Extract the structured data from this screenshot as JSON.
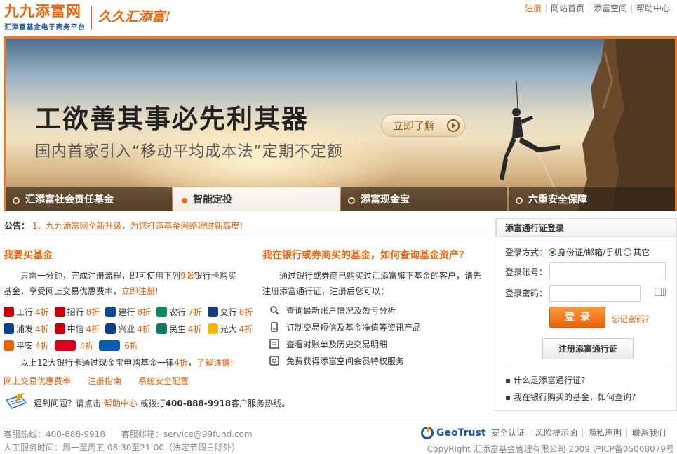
{
  "header": {
    "logo_text": "九九添富网",
    "logo_subtitle": "汇添富基金电子商务平台",
    "slogan": "久久汇添富!",
    "nav": [
      "注册",
      "网站首页",
      "添富空间",
      "帮助中心"
    ]
  },
  "banner": {
    "headline": "工欲善其事必先利其器",
    "subline": "国内首家引入“移动平均成本法”定期不定额",
    "cta_label": "立即了解",
    "tabs": [
      {
        "label": "汇添富社会责任基金",
        "active": false
      },
      {
        "label": "智能定投",
        "active": true
      },
      {
        "label": "添富现金宝",
        "active": false
      },
      {
        "label": "六重安全保障",
        "active": false
      }
    ]
  },
  "notice": {
    "label": "公告：",
    "text": "1、九九添富网全新升级，为您打造基金网络理财新高度!"
  },
  "buy": {
    "title": "我要买基金",
    "intro_before": "只需一分钟，完成注册流程，即可使用下列",
    "intro_count": "9张",
    "intro_after": "银行卡购买基金，享受网上交易优惠费率，",
    "register_link": "立即注册!",
    "banks": [
      [
        {
          "name": "工行",
          "discount": "4折",
          "color": "#c7000b"
        },
        {
          "name": "招行",
          "discount": "8折",
          "color": "#c7000b"
        },
        {
          "name": "建行",
          "discount": "8折",
          "color": "#0b4a9a"
        },
        {
          "name": "农行",
          "discount": "7折",
          "color": "#0a8a5d"
        },
        {
          "name": "交行",
          "discount": "8折",
          "color": "#173b7a"
        }
      ],
      [
        {
          "name": "浦发",
          "discount": "4折",
          "color": "#0a3e8f"
        },
        {
          "name": "中信",
          "discount": "4折",
          "color": "#c7000b"
        },
        {
          "name": "兴业",
          "discount": "4折",
          "color": "#0a3e8f"
        },
        {
          "name": "民生",
          "discount": "4折",
          "color": "#0a7a66"
        },
        {
          "name": "光大",
          "discount": "4折",
          "color": "#f2b705"
        }
      ],
      [
        {
          "name": "平安",
          "discount": "4折",
          "color": "#e8630a"
        },
        {
          "name": "",
          "discount": "4折",
          "color": "#d9001b"
        },
        {
          "name": "",
          "discount": "6折",
          "color": "#0a5bb5"
        }
      ]
    ],
    "note_before": "以上12大银行卡通过现金宝申购基金一律",
    "note_discount": "4折",
    "note_after": "，",
    "note_link": "了解详情!",
    "links": [
      "网上交易优惠费率",
      "注册指南",
      "系统安全配置"
    ]
  },
  "query": {
    "title": "我在银行或券商买的基金，如何查询基金资产？",
    "intro": "通过银行或券商已购买过汇添富旗下基金的客户，请先注册添富通行证，注册后您可以：",
    "features": [
      {
        "icon": "search-icon",
        "text": "查询最新账户情况及盈亏分析"
      },
      {
        "icon": "phone-icon",
        "text": "订制交易短信及基金净值等资讯产品"
      },
      {
        "icon": "statement-icon",
        "text": "查看对账单及历史交易明细"
      },
      {
        "icon": "smile-icon",
        "text": "免费获得添富空间会员特权服务"
      }
    ]
  },
  "help": {
    "before": "遇到问题？请点击",
    "link": "帮助中心",
    "middle": "或拨打",
    "phone": "400-888-9918",
    "after": "客户服务热线。"
  },
  "login": {
    "title": "添富通行证登录",
    "method_label": "登录方式：",
    "method_options": [
      "身份证/邮箱/手机",
      "其它"
    ],
    "account_label": "登录账号：",
    "account_value": "",
    "password_label": "登录密码：",
    "password_value": "",
    "login_button": "登录",
    "forgot_link": "忘记密码?",
    "register_button": "注册添富通行证",
    "questions": [
      "什么是添富通行证?",
      "我在银行购买的基金，如何查询?"
    ]
  },
  "footer": {
    "hotline": "客服热线：400-888-9918",
    "email": "客服邮箱：service@99fund.com",
    "hours": "人工服务时间：周一至周五 08:30至21:00（法定节假日除外）",
    "geotrust": "GeoTrust",
    "links": [
      "安全认证",
      "风险提示函",
      "隐私声明",
      "联系我们"
    ],
    "copyright": "CopyRight 汇添富基金管理有限公司 2009 沪ICP备05008079号"
  }
}
